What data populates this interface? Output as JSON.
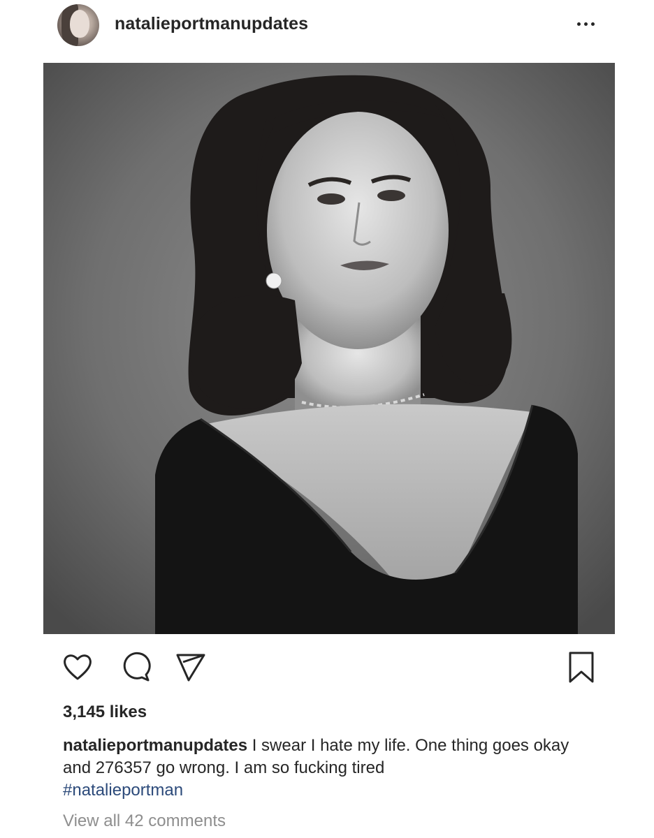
{
  "post": {
    "username": "natalieportmanupdates",
    "more_icon": "more-horizontal-icon",
    "photo_alt": "black-and-white portrait photo"
  },
  "actions": {
    "like_icon": "heart-icon",
    "comment_icon": "comment-icon",
    "share_icon": "send-icon",
    "save_icon": "bookmark-icon"
  },
  "likes": "3,145 likes",
  "caption": {
    "username": "natalieportmanupdates",
    "text": "I swear I hate my life. One thing goes okay and 276357 go wrong. I am so fucking tired",
    "hashtag": "#natalieportman"
  },
  "view_comments": "View all 42 comments",
  "colors": {
    "text": "#262626",
    "muted": "#8e8e8e",
    "hashtag": "#2c4a7a"
  }
}
